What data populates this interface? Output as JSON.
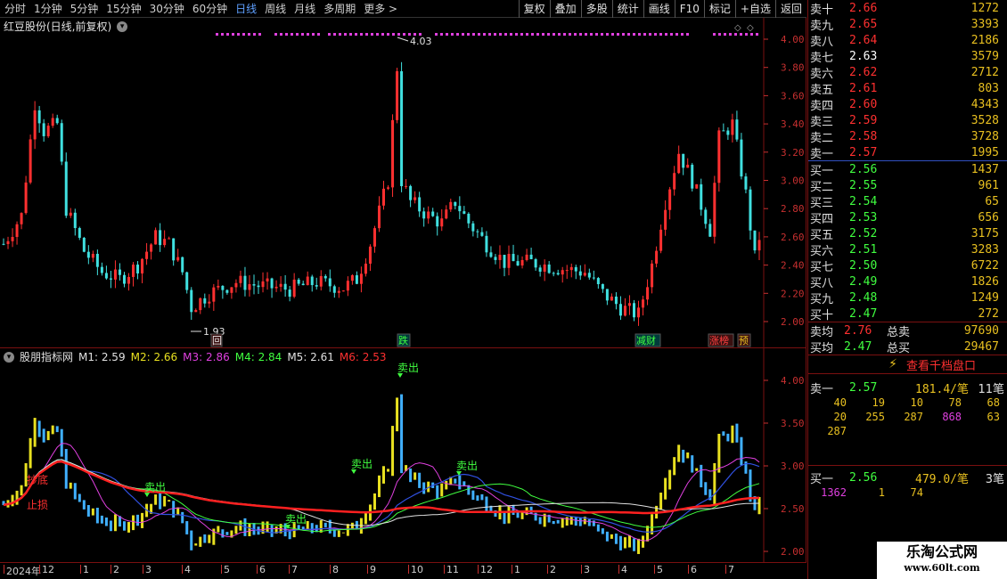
{
  "toolbar": {
    "periods": [
      "分时",
      "1分钟",
      "5分钟",
      "15分钟",
      "30分钟",
      "60分钟",
      "日线",
      "周线",
      "月线",
      "多周期",
      "更多 >"
    ],
    "active_period": "日线",
    "tools": [
      "复权",
      "叠加",
      "多股",
      "统计",
      "画线",
      "F10",
      "标记",
      "+自选",
      "返回"
    ]
  },
  "main_pane": {
    "title": "红豆股份(日线,前复权)",
    "high_marker": "4.03",
    "low_marker": "1.93",
    "y_ticks": [
      "4.00",
      "3.80",
      "3.60",
      "3.40",
      "3.20",
      "3.00",
      "2.80",
      "2.60",
      "2.40",
      "2.20",
      "2.00"
    ],
    "bottom_tags": [
      {
        "text": "回",
        "color": "#e8e8e8"
      },
      {
        "text": "跌",
        "color": "#40ff40"
      },
      {
        "text": "减财",
        "color": "#40ff40"
      },
      {
        "text": "涨榜",
        "color": "#ff4040"
      },
      {
        "text": "预",
        "color": "#e8c020"
      }
    ]
  },
  "indicator_pane": {
    "title": "股朋指标网",
    "params": [
      {
        "label": "M1: 2.59",
        "color": "#e0e0e0"
      },
      {
        "label": "M2: 2.66",
        "color": "#e8e020"
      },
      {
        "label": "M3: 2.86",
        "color": "#e040e0"
      },
      {
        "label": "M4: 2.84",
        "color": "#40ff40"
      },
      {
        "label": "M5: 2.61",
        "color": "#e0e0e0"
      },
      {
        "label": "M6: 2.53",
        "color": "#ff3030"
      }
    ],
    "y_ticks": [
      "4.00",
      "3.50",
      "3.00",
      "2.50",
      "2.00"
    ],
    "signal_label": "卖出",
    "side_labels": [
      "抄底",
      "止损"
    ]
  },
  "time_axis": {
    "labels": [
      "2024年",
      "12",
      "1",
      "2",
      "3",
      "4",
      "5",
      "6",
      "7",
      "8",
      "9",
      "10",
      "11",
      "12",
      "1",
      "2",
      "3",
      "4",
      "5",
      "6",
      "7"
    ],
    "cycle": "日线"
  },
  "order_book": {
    "asks": [
      {
        "label": "卖十",
        "price": "2.66",
        "volume": "1272"
      },
      {
        "label": "卖九",
        "price": "2.65",
        "volume": "3393"
      },
      {
        "label": "卖八",
        "price": "2.64",
        "volume": "2186"
      },
      {
        "label": "卖七",
        "price": "2.63",
        "volume": "3579"
      },
      {
        "label": "卖六",
        "price": "2.62",
        "volume": "2712"
      },
      {
        "label": "卖五",
        "price": "2.61",
        "volume": "803"
      },
      {
        "label": "卖四",
        "price": "2.60",
        "volume": "4343"
      },
      {
        "label": "卖三",
        "price": "2.59",
        "volume": "3528"
      },
      {
        "label": "卖二",
        "price": "2.58",
        "volume": "3728"
      },
      {
        "label": "卖一",
        "price": "2.57",
        "volume": "1995"
      }
    ],
    "bids": [
      {
        "label": "买一",
        "price": "2.56",
        "volume": "1437"
      },
      {
        "label": "买二",
        "price": "2.55",
        "volume": "961"
      },
      {
        "label": "买三",
        "price": "2.54",
        "volume": "65"
      },
      {
        "label": "买四",
        "price": "2.53",
        "volume": "656"
      },
      {
        "label": "买五",
        "price": "2.52",
        "volume": "3175"
      },
      {
        "label": "买六",
        "price": "2.51",
        "volume": "3283"
      },
      {
        "label": "买七",
        "price": "2.50",
        "volume": "6722"
      },
      {
        "label": "买八",
        "price": "2.49",
        "volume": "1826"
      },
      {
        "label": "买九",
        "price": "2.48",
        "volume": "1249"
      },
      {
        "label": "买十",
        "price": "2.47",
        "volume": "272"
      }
    ],
    "summary": [
      {
        "label": "卖均",
        "price": "2.76",
        "label2": "总卖",
        "volume": "97690"
      },
      {
        "label": "买均",
        "price": "2.47",
        "label2": "总买",
        "volume": "29467"
      }
    ],
    "ten_level_button": "查看千档盘口",
    "ask1_detail": {
      "label": "卖一",
      "price": "2.57",
      "per": "181.4/笔",
      "count": "11笔"
    },
    "ask1_orders": [
      "40",
      "19",
      "10",
      "78",
      "68",
      "20",
      "255",
      "287",
      "868",
      "63",
      "287"
    ],
    "bid1_detail": {
      "label": "买一",
      "price": "2.56",
      "per": "479.0/笔",
      "count": "3笔"
    },
    "bid1_orders": [
      "1362",
      "1",
      "74"
    ]
  },
  "watermark": {
    "line1": "乐淘公式网",
    "line2": "www.60lt.com"
  },
  "colors": {
    "up": "#ff3030",
    "down": "#40e0e0",
    "ask_price": "#ff3030",
    "bid_price": "#40ff40",
    "volume": "#e8c020",
    "border": "#7a1010"
  }
}
